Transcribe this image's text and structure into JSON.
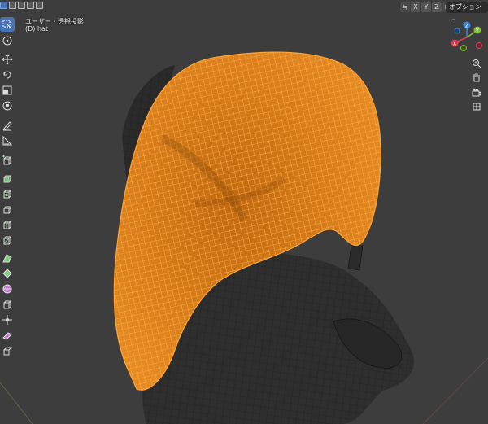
{
  "header": {
    "axes": [
      "X",
      "Y",
      "Z"
    ],
    "options_label": "オプション"
  },
  "viewport": {
    "view_name": "ユーザー・透視投影",
    "object_name": "(D) hat"
  },
  "gizmo": {
    "axis_labels": [
      "Z",
      "Y",
      "X"
    ],
    "colors": {
      "x": "#e4384e",
      "y": "#7fbf2f",
      "z": "#3b86d6",
      "selection": "#f39a2e"
    }
  },
  "toolbar": {
    "tools": [
      "select-box-icon",
      "cursor-icon",
      "move-icon",
      "rotate-icon",
      "scale-icon",
      "transform-icon",
      "annotate-icon",
      "measure-icon",
      "add-cube-icon",
      "extrude-icon",
      "inset-icon",
      "bevel-icon",
      "loop-cut-icon",
      "knife-icon",
      "poly-build-icon",
      "spin-icon",
      "smooth-icon",
      "edge-slide-icon",
      "shrink-fatten-icon",
      "shear-icon",
      "rip-icon"
    ]
  },
  "navigation": {
    "buttons": [
      "zoom-icon",
      "hand-pan-icon",
      "camera-icon",
      "grid-view-icon"
    ]
  }
}
